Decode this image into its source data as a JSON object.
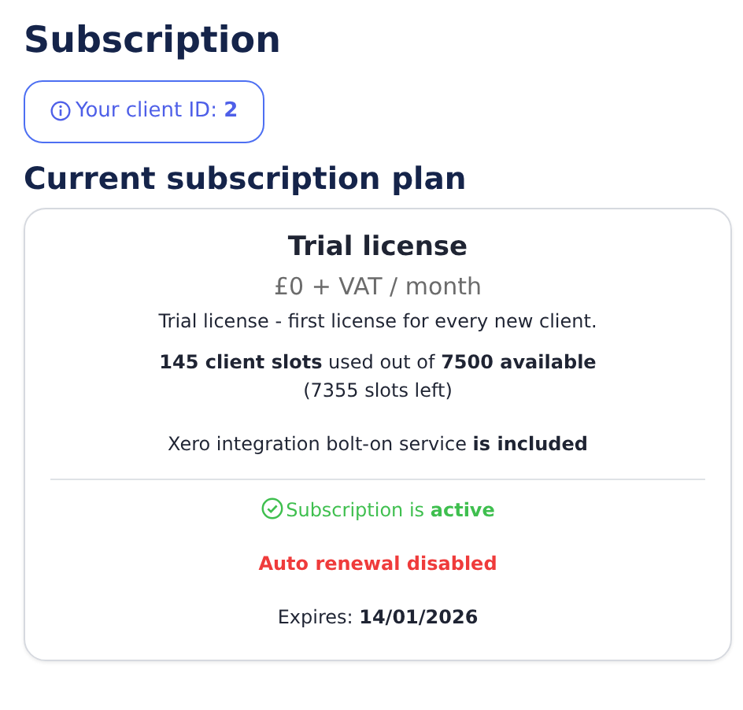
{
  "page_title": "Subscription",
  "client_id_button": {
    "label": "Your client ID: **2**"
  },
  "section_title": "Current subscription plan",
  "plan": {
    "name": "Trial license",
    "price": "£0 + VAT / month",
    "description": "Trial license - first license for every new client.",
    "usage": "**145 client slots** used out of **7500 available**",
    "slots_left": "(7355 slots left)",
    "addon": "Xero integration bolt-on service **is included**"
  },
  "status": {
    "active": true,
    "text": "Subscription is **active**"
  },
  "renewal": {
    "auto_renewal": false,
    "text": "Auto renewal disabled"
  },
  "expiry": "Expires: **14/01/2026**"
}
